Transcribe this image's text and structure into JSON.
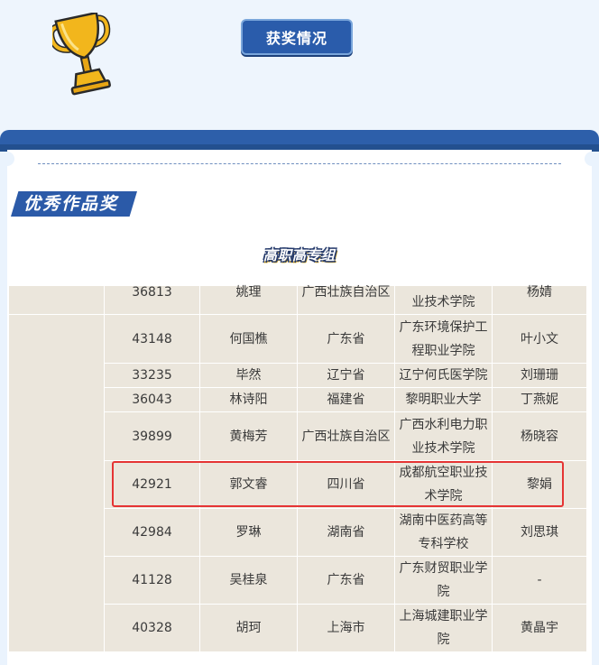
{
  "header": {
    "award_button_label": "获奖情况"
  },
  "section": {
    "title": "优秀作品奖",
    "group_label": "高职高专组"
  },
  "table": {
    "rows": [
      {
        "id": "36813",
        "name": "姚理",
        "province": "广西壮族自治区",
        "school": "业技术学院",
        "teacher": "杨婧"
      },
      {
        "id": "43148",
        "name": "何国樵",
        "province": "广东省",
        "school": "广东环境保护工程职业学院",
        "teacher": "叶小文"
      },
      {
        "id": "33235",
        "name": "毕然",
        "province": "辽宁省",
        "school": "辽宁何氏医学院",
        "teacher": "刘珊珊"
      },
      {
        "id": "36043",
        "name": "林诗阳",
        "province": "福建省",
        "school": "黎明职业大学",
        "teacher": "丁燕妮"
      },
      {
        "id": "39899",
        "name": "黄梅芳",
        "province": "广西壮族自治区",
        "school": "广西水利电力职业技术学院",
        "teacher": "杨晓容"
      },
      {
        "id": "42921",
        "name": "郭文睿",
        "province": "四川省",
        "school": "成都航空职业技术学院",
        "teacher": "黎娟"
      },
      {
        "id": "42984",
        "name": "罗琳",
        "province": "湖南省",
        "school": "湖南中医药高等专科学校",
        "teacher": "刘思琪"
      },
      {
        "id": "41128",
        "name": "吴桂泉",
        "province": "广东省",
        "school": "广东财贸职业学院",
        "teacher": "-"
      },
      {
        "id": "40328",
        "name": "胡珂",
        "province": "上海市",
        "school": "上海城建职业学院",
        "teacher": "黄晶宇"
      }
    ]
  },
  "colors": {
    "accent_blue": "#2b5aa8",
    "table_bg": "#ebe6dc",
    "highlight_red": "#e53434",
    "trophy_gold": "#f2b61c"
  }
}
